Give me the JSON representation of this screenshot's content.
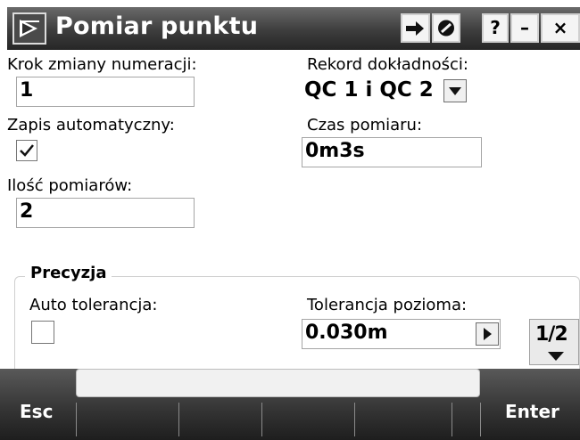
{
  "window": {
    "title": "Pomiar punktu",
    "title_buttons": [
      "?",
      "–",
      "×"
    ]
  },
  "form": {
    "step_label": "Krok zmiany numeracji:",
    "step_value": "1",
    "record_label": "Rekord dokładności:",
    "record_value": "QC 1 i QC 2",
    "autosave_label": "Zapis automatyczny:",
    "autosave_checked": true,
    "duration_label": "Czas pomiaru:",
    "duration_value": "0m3s",
    "count_label": "Ilość pomiarów:",
    "count_value": "2"
  },
  "precision": {
    "group_title": "Precyzja",
    "auto_tol_label": "Auto tolerancja:",
    "auto_tol_checked": false,
    "h_tol_label": "Tolerancja pozioma:",
    "h_tol_value": "0.030m",
    "page_indicator": "1/2"
  },
  "softkeys": {
    "esc": "Esc",
    "enter": "Enter"
  },
  "colors": {
    "titlebar": "#3d3d3d",
    "softbar": "#333333"
  }
}
